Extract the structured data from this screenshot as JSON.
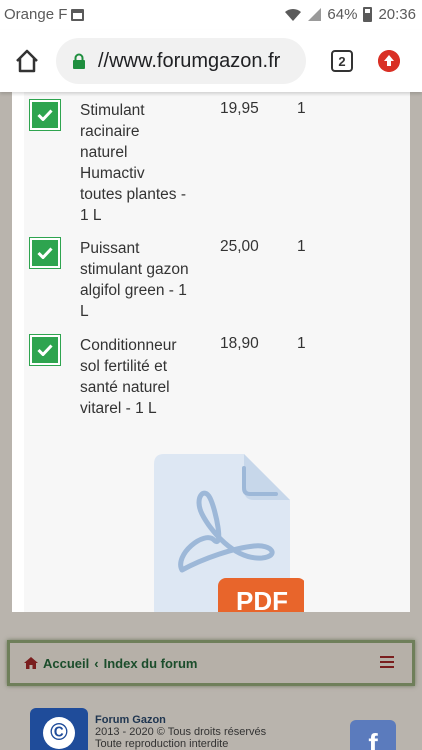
{
  "status_bar": {
    "carrier": "Orange F",
    "battery": "64%",
    "time": "20:36"
  },
  "browser": {
    "url": "//www.forumgazon.fr",
    "tab_count": "2"
  },
  "products": [
    {
      "name": "Stimulant racinaire naturel Humactiv toutes plantes - 1 L",
      "price": "19,95",
      "qty": "1",
      "checked": true
    },
    {
      "name": "Puissant stimulant gazon algifol green - 1 L",
      "price": "25,00",
      "qty": "1",
      "checked": true
    },
    {
      "name": "Conditionneur sol fertilité et santé naturel vitarel - 1 L",
      "price": "18,90",
      "qty": "1",
      "checked": true
    }
  ],
  "pdf_label": "PDF",
  "breadcrumb": {
    "home": "Accueil",
    "separator": "‹",
    "index": "Index du forum"
  },
  "footer": {
    "site": "Forum Gazon",
    "copyright": "2013 - 2020 © Tous droits réservés",
    "notice": "Toute reproduction interdite",
    "logo_symbol": "©",
    "facebook_letter": "f"
  },
  "colors": {
    "check_green": "#2ea44f",
    "pdf_orange": "#e8652b",
    "breadcrumb_green": "#1b4d2b",
    "menu_red": "#d93025"
  }
}
